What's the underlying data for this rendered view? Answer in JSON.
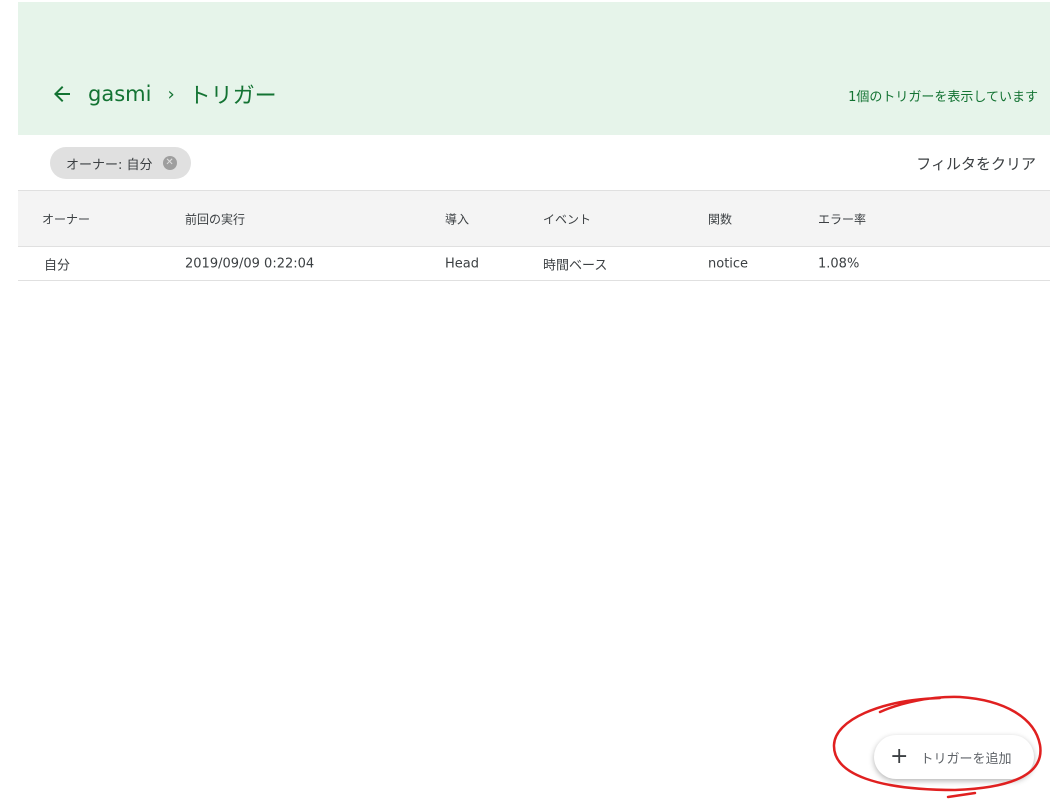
{
  "header": {
    "breadcrumb_project": "gasmi",
    "breadcrumb_current": "トリガー",
    "trigger_count_text": "1個のトリガーを表示しています"
  },
  "filter": {
    "chip_label": "オーナー: 自分",
    "clear_label": "フィルタをクリア"
  },
  "table": {
    "columns": [
      "オーナー",
      "前回の実行",
      "導入",
      "イベント",
      "関数",
      "エラー率"
    ],
    "rows": [
      [
        "自分",
        "2019/09/09 0:22:04",
        "Head",
        "時間ベース",
        "notice",
        "1.08%"
      ]
    ]
  },
  "fab": {
    "label": "トリガーを追加"
  },
  "colors": {
    "header_bg": "#e6f4ea",
    "accent": "#137333",
    "annotation": "#e02020"
  }
}
